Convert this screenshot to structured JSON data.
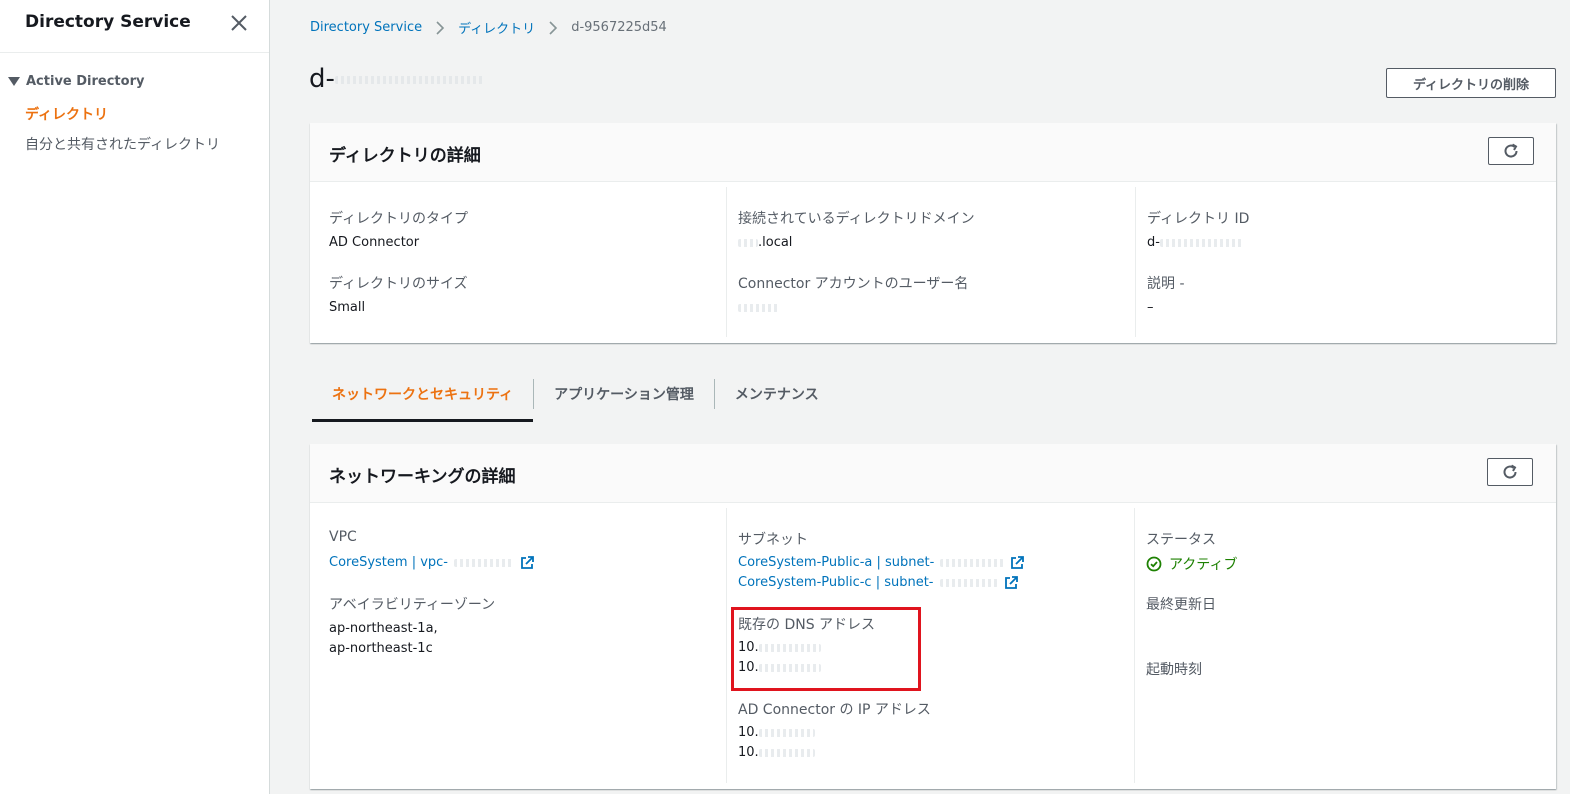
{
  "sidebar": {
    "title": "Directory Service",
    "section": "Active Directory",
    "items": [
      {
        "label": "ディレクトリ",
        "active": true
      },
      {
        "label": "自分と共有されたディレクトリ",
        "active": false
      }
    ]
  },
  "breadcrumb": {
    "items": [
      "Directory Service",
      "ディレクトリ"
    ],
    "current": "d-9567225d54"
  },
  "page": {
    "title_prefix": "d-",
    "delete_button": "ディレクトリの削除"
  },
  "details": {
    "title": "ディレクトリの詳細",
    "directory_type_label": "ディレクトリのタイプ",
    "directory_type": "AD Connector",
    "directory_size_label": "ディレクトリのサイズ",
    "directory_size": "Small",
    "connected_domain_label": "接続されているディレクトリドメイン",
    "connected_domain": ".local",
    "connector_account_label": "Connector アカウントのユーザー名",
    "directory_id_label": "ディレクトリ ID",
    "directory_id_prefix": "d-",
    "description_label": "説明 -",
    "description": "–"
  },
  "tabs": [
    {
      "label": "ネットワークとセキュリティ",
      "active": true
    },
    {
      "label": "アプリケーション管理",
      "active": false
    },
    {
      "label": "メンテナンス",
      "active": false
    }
  ],
  "networking": {
    "title": "ネットワーキングの詳細",
    "vpc_label": "VPC",
    "vpc_value": "CoreSystem | vpc-",
    "az_label": "アベイラビリティーゾーン",
    "az_values": [
      "ap-northeast-1a,",
      "ap-northeast-1c"
    ],
    "subnet_label": "サブネット",
    "subnets": [
      "CoreSystem-Public-a | subnet-",
      "CoreSystem-Public-c | subnet-"
    ],
    "dns_label": "既存の DNS アドレス",
    "dns_values": [
      "10.",
      "10."
    ],
    "ip_label": "AD Connector の IP アドレス",
    "ip_values": [
      "10.",
      "10."
    ],
    "status_label": "ステータス",
    "status_value": "アクティブ",
    "last_updated_label": "最終更新日",
    "launch_time_label": "起動時刻"
  },
  "colors": {
    "accent": "#ec7211",
    "link": "#0073bb",
    "success": "#1d8102",
    "highlight": "#e0141e"
  },
  "icons": [
    "close-icon",
    "caret-down-icon",
    "chevron-right-icon",
    "refresh-icon",
    "external-link-icon",
    "status-success-icon"
  ]
}
